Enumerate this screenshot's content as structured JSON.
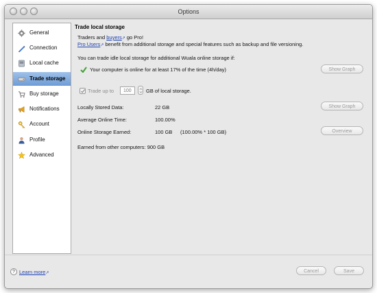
{
  "window": {
    "title": "Options"
  },
  "sidebar": {
    "items": [
      {
        "label": "General",
        "icon": "gear-icon",
        "selected": false
      },
      {
        "label": "Connection",
        "icon": "pen-icon",
        "selected": false
      },
      {
        "label": "Local cache",
        "icon": "drive-icon",
        "selected": false
      },
      {
        "label": "Trade storage",
        "icon": "storage-icon",
        "selected": true
      },
      {
        "label": "Buy storage",
        "icon": "cart-icon",
        "selected": false
      },
      {
        "label": "Notifications",
        "icon": "megaphone-icon",
        "selected": false
      },
      {
        "label": "Account",
        "icon": "key-icon",
        "selected": false
      },
      {
        "label": "Profile",
        "icon": "person-icon",
        "selected": false
      },
      {
        "label": "Advanced",
        "icon": "star-icon",
        "selected": false
      }
    ]
  },
  "panel": {
    "title": "Trade local storage",
    "intro_prefix": "Traders and ",
    "intro_link": "buyers",
    "intro_suffix": " go Pro!",
    "pro_link": "Pro Users",
    "pro_suffix": " benefit from additional storage and special features such as backup and file versioning.",
    "trade_condition": "You can trade idle local storage for additional Wuala online storage if:",
    "online_status": "Your computer is online for at least 17% of the time (4h/day)",
    "show_graph_1": "Show Graph",
    "trade_up_to": "Trade up to",
    "trade_value": "100",
    "trade_unit": "GB of local storage.",
    "locally_stored_label": "Locally Stored Data:",
    "locally_stored_value": "22 GB",
    "show_graph_2": "Show Graph",
    "avg_online_label": "Average Online Time:",
    "avg_online_value": "100.00%",
    "online_earned_label": "Online Storage Earned:",
    "online_earned_value": "100 GB",
    "online_earned_formula": "(100.00% * 100 GB)",
    "overview": "Overview",
    "earned_other": "Earned from other computers: 900 GB"
  },
  "footer": {
    "help": "?",
    "learn_more": "Learn more",
    "cancel": "Cancel",
    "save": "Save"
  },
  "colors": {
    "selection": "#7ea8df",
    "link": "#1a3fb0",
    "check": "#3ea232"
  }
}
